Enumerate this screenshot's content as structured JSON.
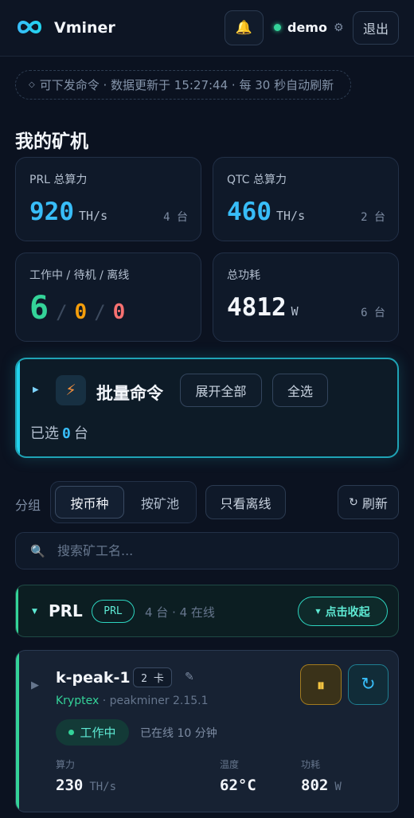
{
  "header": {
    "brand": "Vminer",
    "user": "demo",
    "logout": "退出"
  },
  "info_bar": "可下发命令 · 数据更新于 15:27:44 · 每 30 秒自动刷新",
  "section_title": "我的矿机",
  "stats": {
    "prl": {
      "label": "PRL 总算力",
      "value": "920",
      "unit": "TH/s",
      "count": "4 台"
    },
    "qtc": {
      "label": "QTC 总算力",
      "value": "460",
      "unit": "TH/s",
      "count": "2 台"
    },
    "status": {
      "label": "工作中 / 待机 / 离线",
      "working": "6",
      "idle": "0",
      "offline": "0",
      "sep": "/"
    },
    "power": {
      "label": "总功耗",
      "value": "4812",
      "unit": "W",
      "count": "6 台"
    }
  },
  "batch": {
    "title": "批量命令",
    "expand_all": "展开全部",
    "select_all": "全选",
    "selected_prefix": "已选",
    "selected_count": "0",
    "selected_suffix": "台"
  },
  "grouping": {
    "label": "分组",
    "by_coin": "按币种",
    "by_pool": "按矿池",
    "offline_only": "只看离线",
    "refresh": "刷新"
  },
  "search": {
    "placeholder": "搜索矿工名..."
  },
  "group": {
    "name": "PRL",
    "badge": "PRL",
    "meta": "4 台 · 4 在线",
    "collapse": "点击收起"
  },
  "miner": {
    "name": "k-peak-1",
    "cards": "2 卡",
    "vendor": "Kryptex",
    "software": " · peakminer 2.15.1",
    "state": "工作中",
    "online_for": "已在线 10 分钟",
    "hashrate_label": "算力",
    "hashrate": "230",
    "hashrate_unit": "TH/s",
    "temp_label": "温度",
    "temp": "62°C",
    "power_label": "功耗",
    "power": "802",
    "power_unit": "W"
  },
  "colors": {
    "background": "#0b1220",
    "accent_cyan": "#38bdf8",
    "working_green": "#34d399",
    "idle_amber": "#f59e0b",
    "offline_red": "#f87171"
  },
  "icons": [
    "infinity-logo-icon",
    "bell-icon",
    "gear-icon",
    "bolt-icon",
    "search-icon",
    "refresh-icon",
    "pencil-icon",
    "pause-icon",
    "restart-icon"
  ]
}
